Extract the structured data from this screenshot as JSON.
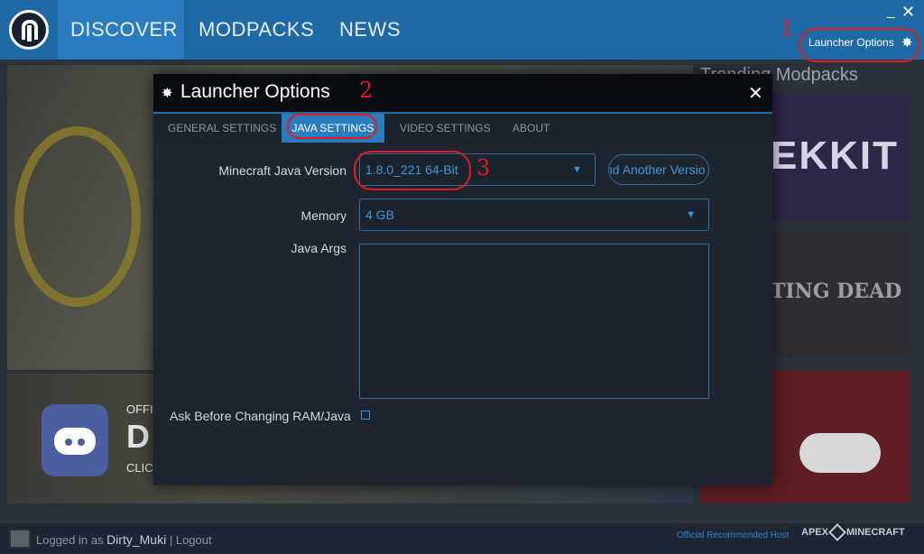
{
  "topbar": {
    "tabs": [
      {
        "label": "DISCOVER"
      },
      {
        "label": "MODPACKS"
      },
      {
        "label": "NEWS"
      }
    ],
    "minimize_glyph": "_",
    "close_glyph": "✕",
    "launcher_options_label": "Launcher Options"
  },
  "background": {
    "trending_title": "Trending Modpacks",
    "pack_titles": [
      "EKKIT",
      "TING DEAD"
    ],
    "discord_text_1": "OFFI",
    "discord_text_2": "D",
    "discord_text_3": "CLIC"
  },
  "dialog": {
    "title": "Launcher Options",
    "close_glyph": "✕",
    "tabs": [
      {
        "label": "GENERAL SETTINGS"
      },
      {
        "label": "JAVA SETTINGS"
      },
      {
        "label": "VIDEO SETTINGS"
      },
      {
        "label": "ABOUT"
      }
    ],
    "fields": {
      "java_version_label": "Minecraft Java Version",
      "java_version_value": "1.8.0_221 64-Bit",
      "find_button_label": "nd Another Versio",
      "memory_label": "Memory",
      "memory_value": "4 GB",
      "java_args_label": "Java Args",
      "ask_label": "Ask Before Changing RAM/Java"
    }
  },
  "footer": {
    "logged_in_prefix": "Logged in as",
    "username": "Dirty_Muki",
    "separator": "|",
    "logout": "Logout",
    "host_label": "Official Recommended Host",
    "host_brand_left": "APEX",
    "host_brand_right": "MINECRAFT"
  },
  "annotations": {
    "mark_1": "1",
    "mark_2": "2",
    "mark_3": "3"
  },
  "colors": {
    "topbar": "#1f6aa5",
    "accent": "#2b7cbf",
    "link": "#3d97e0",
    "annotation": "#e11b22"
  },
  "icons": {
    "app_logo": "technic-logo-icon",
    "settings": "gear-icon",
    "dropdown": "caret-down-icon"
  }
}
